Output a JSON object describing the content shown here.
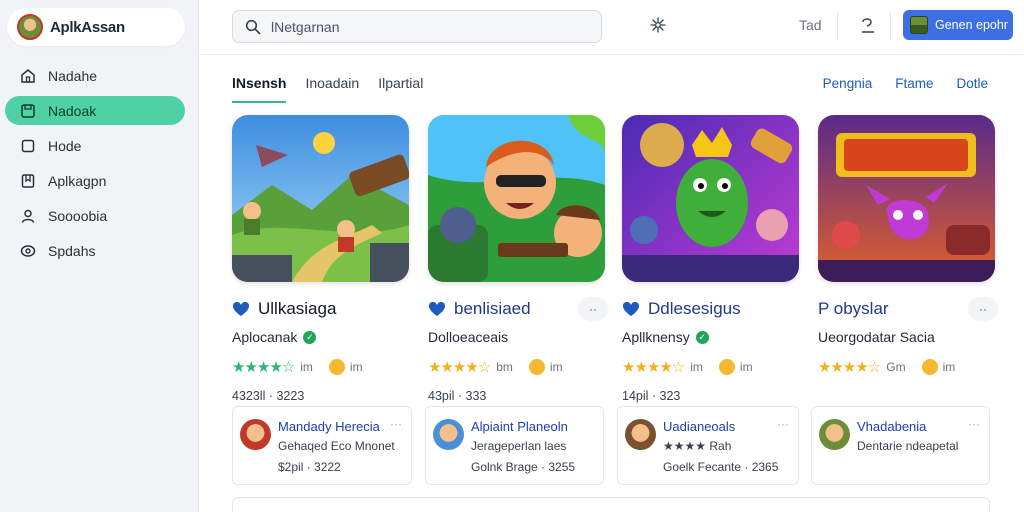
{
  "brand": {
    "name": "AplkAssan",
    "logo_icon": "avatar-logo-icon"
  },
  "sidebar": {
    "items": [
      {
        "label": "Nadahe",
        "icon": "home-icon",
        "active": false
      },
      {
        "label": "Nadoak",
        "icon": "save-square-icon",
        "active": true
      },
      {
        "label": "Hode",
        "icon": "square-icon",
        "active": false
      },
      {
        "label": "Aplkagpn",
        "icon": "bookmark-box-icon",
        "active": false
      },
      {
        "label": "Soooobia",
        "icon": "user-icon",
        "active": false
      },
      {
        "label": "Spdahs",
        "icon": "eye-icon",
        "active": false
      }
    ]
  },
  "topbar": {
    "search_value": "lNetgarnan",
    "t_label": "Tad",
    "button_label": "Genen epohr"
  },
  "main": {
    "tabs": [
      "lNsensh",
      "Inoadain",
      "Ilpartial"
    ],
    "active_tab": 0,
    "links": [
      "Pengnia",
      "Ftame",
      "Dotle"
    ]
  },
  "cards": [
    {
      "title": "Ullkasiaga",
      "publisher": "Aplocanak",
      "verified": true,
      "stars": "★★★★☆",
      "rating_text": "im",
      "emoji_text": "im",
      "meta": "4323ll · 3223",
      "star_color": "#2bb673",
      "show_dots": false
    },
    {
      "title": "benlisiaed",
      "publisher": "Dolloeaceais",
      "verified": false,
      "stars": "★★★★☆",
      "rating_text": "bm",
      "emoji_text": "im",
      "meta": "43pil · 333",
      "star_color": "#f2b01e",
      "show_dots": true
    },
    {
      "title": "Ddlesesigus",
      "publisher": "Apllknensy",
      "verified": true,
      "stars": "★★★★☆",
      "rating_text": "im",
      "emoji_text": "im",
      "meta": "14pil · 323",
      "star_color": "#f2b01e",
      "show_dots": false
    },
    {
      "title": "P obyslar",
      "publisher": "Ueorgodatar Sacia",
      "verified": false,
      "stars": "★★★★☆",
      "rating_text": "Gm",
      "emoji_text": "im",
      "meta": "",
      "star_color": "#f2b01e",
      "show_dots": true
    }
  ],
  "mini_cards": [
    {
      "name": "Mandady Herecia",
      "sub": "Gehaqed Eco Mnonet",
      "meta": "$2pil · 3222",
      "avatar_color": "#c0392b"
    },
    {
      "name": "Alpiaint Planeoln",
      "sub": "Jerageperlan laes",
      "meta": "Golnk Brage · 3255",
      "avatar_color": "#4b8fd6"
    },
    {
      "name": "Uadianeoals",
      "sub": "★★★★ Rah",
      "meta": "Goelk Fecante · 2365",
      "avatar_color": "#7a5230"
    },
    {
      "name": "Vhadabenia",
      "sub": "Dentarie ndeapetal",
      "meta": "",
      "avatar_color": "#6b8e3a"
    }
  ],
  "colors": {
    "accent": "#4fd1a5",
    "link": "#1e5bbf",
    "primary_button": "#3b6fe3"
  }
}
